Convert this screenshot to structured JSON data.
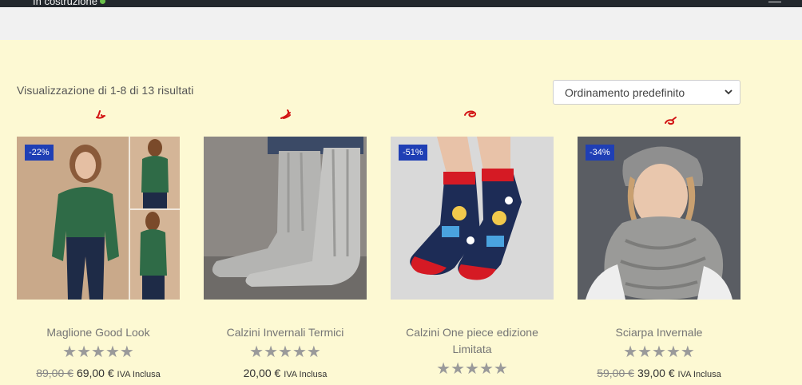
{
  "topbar": {
    "label": "In costruzione"
  },
  "shop": {
    "result_count": "Visualizzazione di 1-8 di 13 risultati",
    "orderby": "Ordinamento predefinito"
  },
  "products": [
    {
      "title": "Maglione Good Look",
      "badge": "-22%",
      "rating_stars": "★★★★★",
      "old_price": "89,00 €",
      "price": "69,00 €",
      "suffix": "IVA Inclusa",
      "image": "green-sweater-photo"
    },
    {
      "title": "Calzini Invernali Termici",
      "badge": "",
      "rating_stars": "★★★★★",
      "old_price": "",
      "price": "20,00 €",
      "suffix": "IVA Inclusa",
      "image": "grey-wool-socks-photo"
    },
    {
      "title": "Calzini One piece edizione Limitata",
      "badge": "-51%",
      "rating_stars": "★★★★★",
      "old_price": "",
      "price": "",
      "suffix": "",
      "image": "one-piece-socks-photo"
    },
    {
      "title": "Sciarpa Invernale",
      "badge": "-34%",
      "rating_stars": "★★★★★",
      "old_price": "59,00 €",
      "price": "39,00 €",
      "suffix": "IVA Inclusa",
      "image": "grey-scarf-photo"
    }
  ],
  "colors": {
    "background": "#fdf9d3",
    "badge": "#1f3fb5",
    "topbar": "#23282d",
    "stars": "#9a9a9a"
  }
}
